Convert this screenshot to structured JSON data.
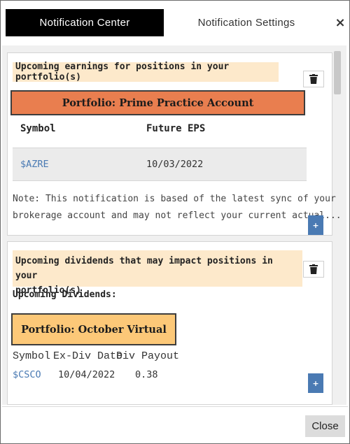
{
  "header": {
    "tabs": [
      {
        "label": "Notification Center",
        "active": true
      },
      {
        "label": "Notification Settings",
        "active": false
      }
    ],
    "close_label": "×"
  },
  "notifications": [
    {
      "banner": "Upcoming earnings for positions in your portfolio(s)",
      "portfolio_label": "Portfolio:  Prime Practice Account",
      "portfolio_color": "#e97e4f",
      "table": {
        "headers": [
          "Symbol",
          "Future EPS"
        ],
        "rows": [
          [
            "$AZRE",
            "10/03/2022"
          ]
        ]
      },
      "note_lines": [
        "Note: This notification is based of the latest sync of your",
        "brokerage account and may not reflect your current actual..."
      ],
      "expand_label": "+"
    },
    {
      "banner_lines": [
        "Upcoming dividends that may impact positions in your",
        "portfolio(s)"
      ],
      "section_label": "Upcoming Dividends:",
      "portfolio_label": "Portfolio:  October Virtual",
      "portfolio_color": "#fcc878",
      "table": {
        "headers": [
          "Symbol",
          "Ex-Div Date",
          "Div Payout"
        ],
        "rows": [
          [
            "$CSCO",
            "10/04/2022",
            "0.38"
          ]
        ]
      },
      "expand_label": "+"
    }
  ],
  "footer": {
    "close_button": "Close"
  },
  "colors": {
    "accent_blue": "#4a7ab3",
    "banner_bg": "#fde9cb",
    "tab_active_bg": "#000000"
  }
}
